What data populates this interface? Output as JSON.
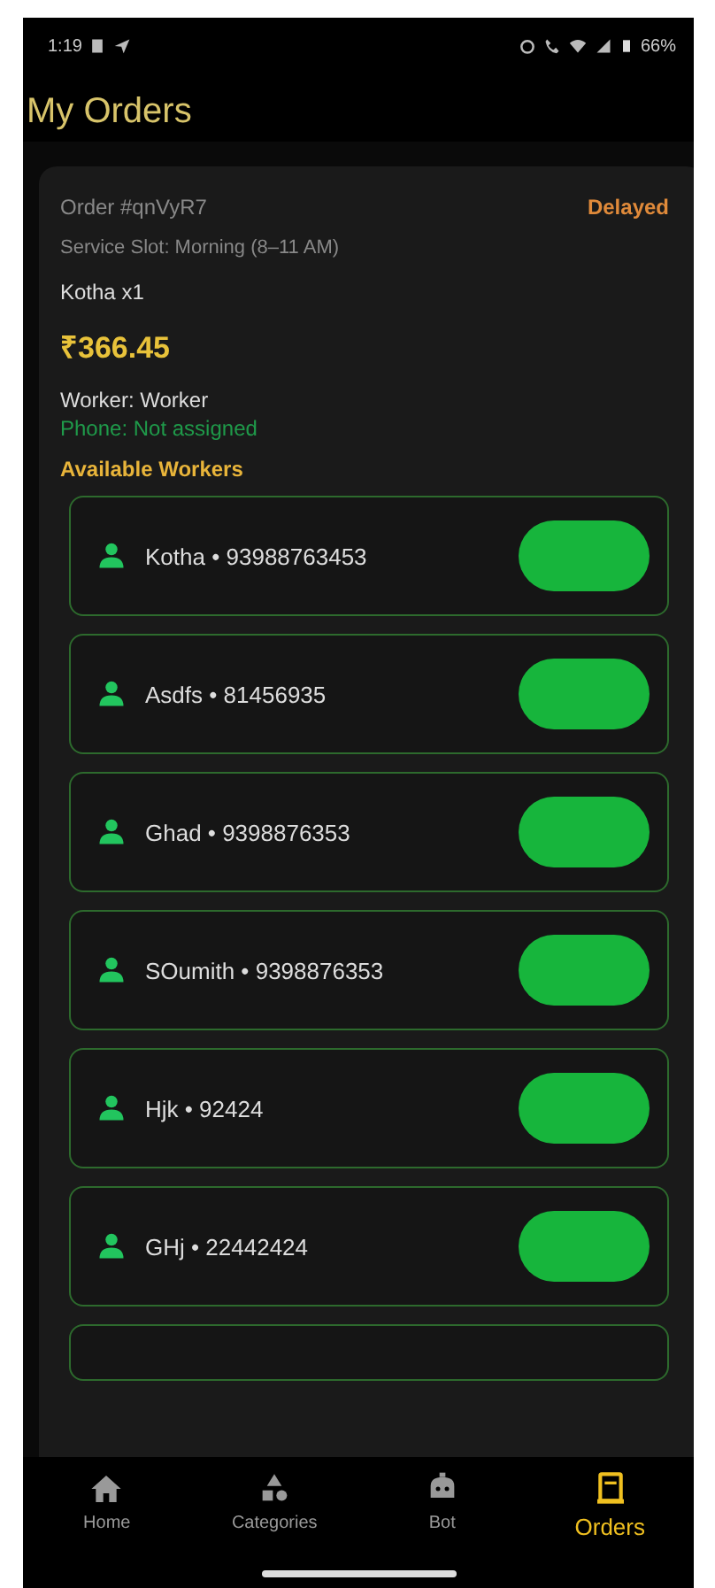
{
  "status_bar": {
    "time": "1:19",
    "battery": "66%"
  },
  "title": "My Orders",
  "order": {
    "number": "Order #qnVyR7",
    "status": "Delayed",
    "slot": "Service Slot: Morning (8–11 AM)",
    "item": "Kotha  x1",
    "price": "₹366.45",
    "worker": "Worker: Worker",
    "phone": "Phone: Not assigned",
    "workers_heading": "Available Workers",
    "workers": [
      {
        "label": "Kotha • 93988763453"
      },
      {
        "label": "Asdfs • 81456935"
      },
      {
        "label": "Ghad • 9398876353"
      },
      {
        "label": "SOumith • 9398876353"
      },
      {
        "label": "Hjk • 92424"
      },
      {
        "label": "GHj • 22442424"
      }
    ]
  },
  "nav": [
    {
      "label": "Home",
      "kind": "home",
      "selected": false
    },
    {
      "label": "Categories",
      "kind": "categories",
      "selected": false
    },
    {
      "label": "Bot",
      "kind": "bot",
      "selected": false
    },
    {
      "label": "Orders",
      "kind": "orders",
      "selected": true
    }
  ]
}
